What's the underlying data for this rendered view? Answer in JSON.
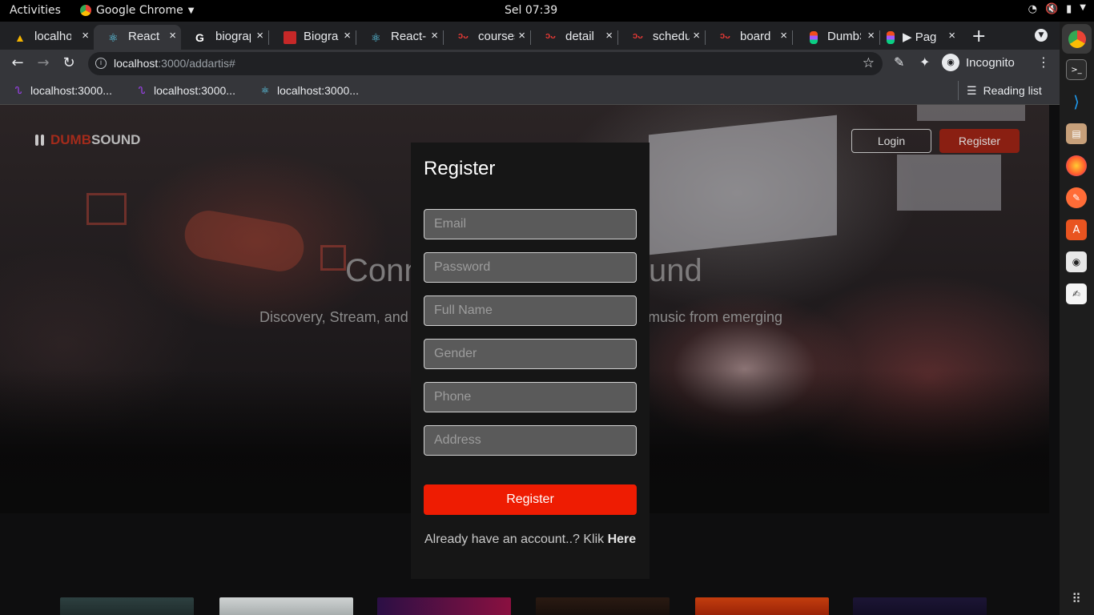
{
  "system": {
    "activities": "Activities",
    "app_name": "Google Chrome",
    "clock": "Sel 07:39"
  },
  "browser": {
    "tabs": [
      {
        "label": "localhost",
        "close": "×"
      },
      {
        "label": "React App",
        "close": "×"
      },
      {
        "label": "biography",
        "close": "×"
      },
      {
        "label": "Biography",
        "close": "×"
      },
      {
        "label": "React-Bootstrap",
        "close": "×"
      },
      {
        "label": "courses",
        "close": "×"
      },
      {
        "label": "detail",
        "close": "×"
      },
      {
        "label": "schedule",
        "close": "×"
      },
      {
        "label": "board",
        "close": "×"
      },
      {
        "label": "DumbSound",
        "close": "×"
      },
      {
        "label": "▶ Page",
        "close": "×"
      }
    ],
    "url_host": "localhost",
    "url_rest": ":3000/addartis#",
    "incognito_label": "Incognito",
    "bookmarks": [
      "localhost:3000...",
      "localhost:3000...",
      "localhost:3000..."
    ],
    "reading_list": "Reading list"
  },
  "site": {
    "logo_dumb": "DUMB",
    "logo_sound": "SOUND",
    "login_label": "Login",
    "register_label": "Register",
    "hero_title_start": "Conn",
    "hero_title_end": "und",
    "hero_sub_start": "Discovery, Stream, and",
    "hero_sub_end": "music from emerging"
  },
  "modal": {
    "title": "Register",
    "fields": {
      "email": "Email",
      "password": "Password",
      "full_name": "Full Name",
      "gender": "Gender",
      "phone": "Phone",
      "address": "Address"
    },
    "submit_label": "Register",
    "switch_text": "Already have an account..? Klik ",
    "switch_link": "Here"
  },
  "colors": {
    "accent": "#ee1c02",
    "brand_dark": "#8a1f12",
    "modal_bg": "#161616"
  }
}
